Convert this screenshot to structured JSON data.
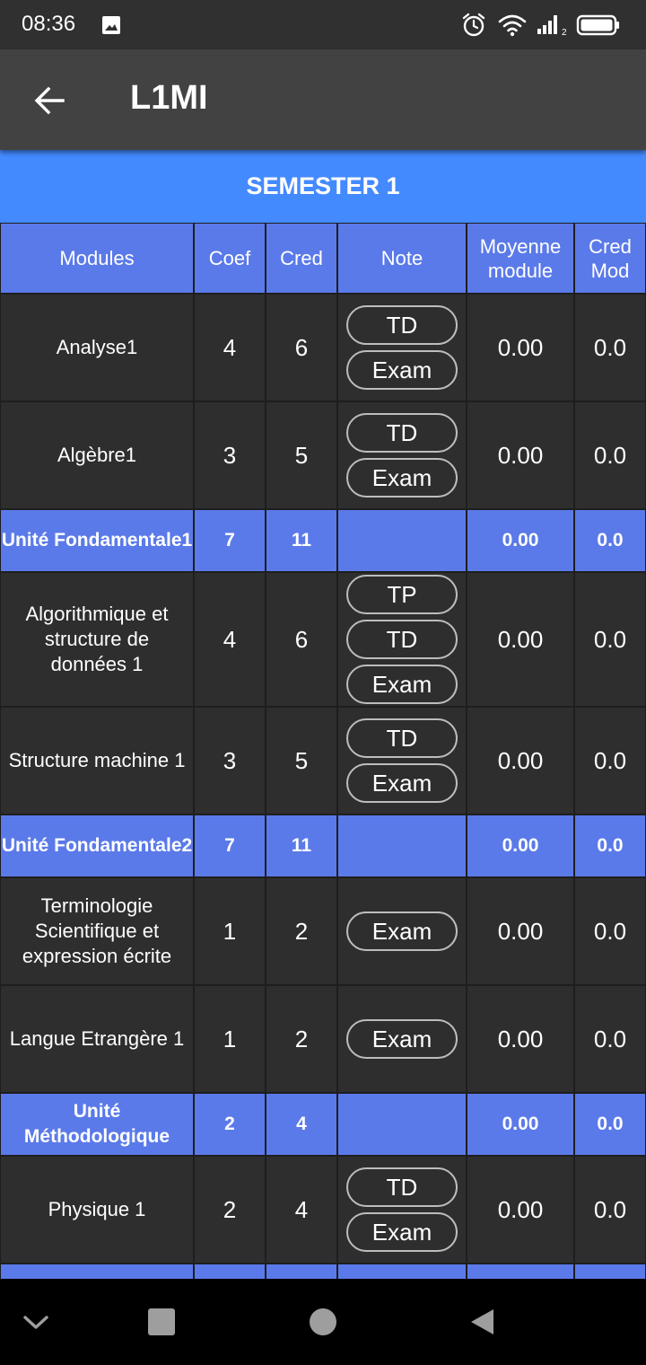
{
  "status_bar": {
    "time": "08:36"
  },
  "app_bar": {
    "title": "L1MI"
  },
  "semester": {
    "title": "SEMESTER 1"
  },
  "table": {
    "headers": [
      "Modules",
      "Coef",
      "Cred",
      "Note",
      "Moyenne module",
      "Cred Mod"
    ],
    "rows": [
      {
        "type": "module",
        "name": "Analyse1",
        "coef": "4",
        "cred": "6",
        "notes": [
          "TD",
          "Exam"
        ],
        "moyenne": "0.00",
        "cred_mod": "0.0"
      },
      {
        "type": "module",
        "name": "Algèbre1",
        "coef": "3",
        "cred": "5",
        "notes": [
          "TD",
          "Exam"
        ],
        "moyenne": "0.00",
        "cred_mod": "0.0"
      },
      {
        "type": "unit",
        "name": "Unité Fondamentale1",
        "coef": "7",
        "cred": "11",
        "moyenne": "0.00",
        "cred_mod": "0.0"
      },
      {
        "type": "module",
        "name": "Algorithmique et structure de données 1",
        "coef": "4",
        "cred": "6",
        "notes": [
          "TP",
          "TD",
          "Exam"
        ],
        "moyenne": "0.00",
        "cred_mod": "0.0"
      },
      {
        "type": "module",
        "name": "Structure machine 1",
        "coef": "3",
        "cred": "5",
        "notes": [
          "TD",
          "Exam"
        ],
        "moyenne": "0.00",
        "cred_mod": "0.0"
      },
      {
        "type": "unit",
        "name": "Unité Fondamentale2",
        "coef": "7",
        "cred": "11",
        "moyenne": "0.00",
        "cred_mod": "0.0"
      },
      {
        "type": "module",
        "name": "Terminologie Scientifique et expression écrite",
        "coef": "1",
        "cred": "2",
        "notes": [
          "Exam"
        ],
        "moyenne": "0.00",
        "cred_mod": "0.0"
      },
      {
        "type": "module",
        "name": "Langue Etrangère 1",
        "coef": "1",
        "cred": "2",
        "notes": [
          "Exam"
        ],
        "moyenne": "0.00",
        "cred_mod": "0.0"
      },
      {
        "type": "unit",
        "name": "Unité Méthodologique",
        "coef": "2",
        "cred": "4",
        "moyenne": "0.00",
        "cred_mod": "0.0"
      },
      {
        "type": "module",
        "name": "Physique 1",
        "coef": "2",
        "cred": "4",
        "notes": [
          "TD",
          "Exam"
        ],
        "moyenne": "0.00",
        "cred_mod": "0.0"
      },
      {
        "type": "unit",
        "name": "",
        "coef": "",
        "cred": "",
        "moyenne": "",
        "cred_mod": ""
      }
    ]
  },
  "icons": {
    "status": [
      "gallery-icon",
      "alarm-icon",
      "wifi-icon",
      "signal-icon",
      "battery-icon"
    ],
    "app_bar": "back-arrow-icon",
    "nav": [
      "nav-down-icon",
      "recents-icon",
      "home-icon",
      "nav-back-icon"
    ]
  },
  "colors": {
    "accent": "#448aff",
    "header_cells": "#5b7ae9",
    "cells": "#2e2e2e",
    "app_bar": "#424242",
    "status_bar": "#303030"
  }
}
